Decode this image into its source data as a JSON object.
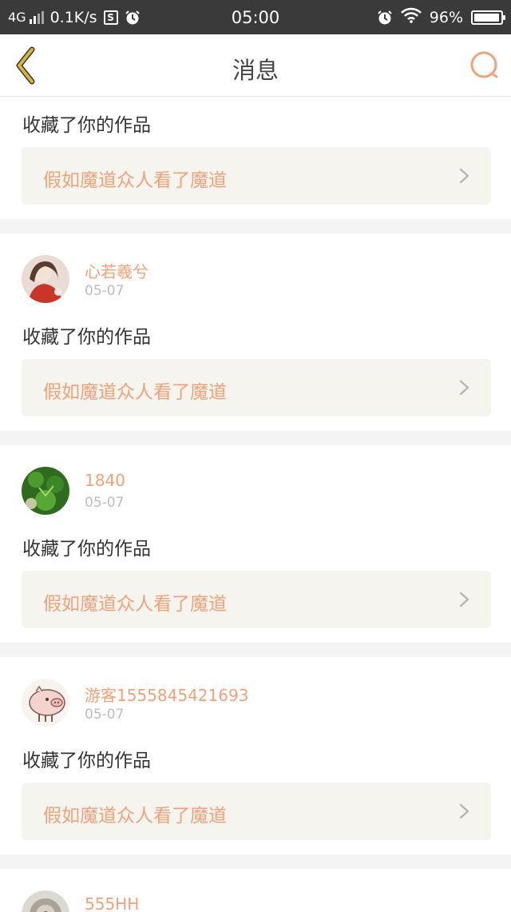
{
  "status_bar": {
    "network": "4G",
    "speed": "0.1K/s",
    "s_badge": "S",
    "time": "05:00",
    "battery": "96%",
    "battery_level": 0.96
  },
  "header": {
    "title": "消息",
    "back_icon": "chevron-left-icon",
    "search_icon": "search-icon"
  },
  "messages": [
    {
      "action": "收藏了你的作品",
      "work_title": "假如魔道众人看了魔道"
    },
    {
      "username": "心若羲兮",
      "date": "05-07",
      "action": "收藏了你的作品",
      "work_title": "假如魔道众人看了魔道"
    },
    {
      "username": "1840",
      "date": "05-07",
      "action": "收藏了你的作品",
      "work_title": "假如魔道众人看了魔道"
    },
    {
      "username": "游客1555845421693",
      "date": "05-07",
      "action": "收藏了你的作品",
      "work_title": "假如魔道众人看了魔道"
    },
    {
      "username": "555HH"
    }
  ],
  "colors": {
    "accent": "#f0a27a",
    "back_icon": "#d9b43a",
    "status_bar": "#3a3a3a",
    "work_bg": "#f5f4ee"
  }
}
